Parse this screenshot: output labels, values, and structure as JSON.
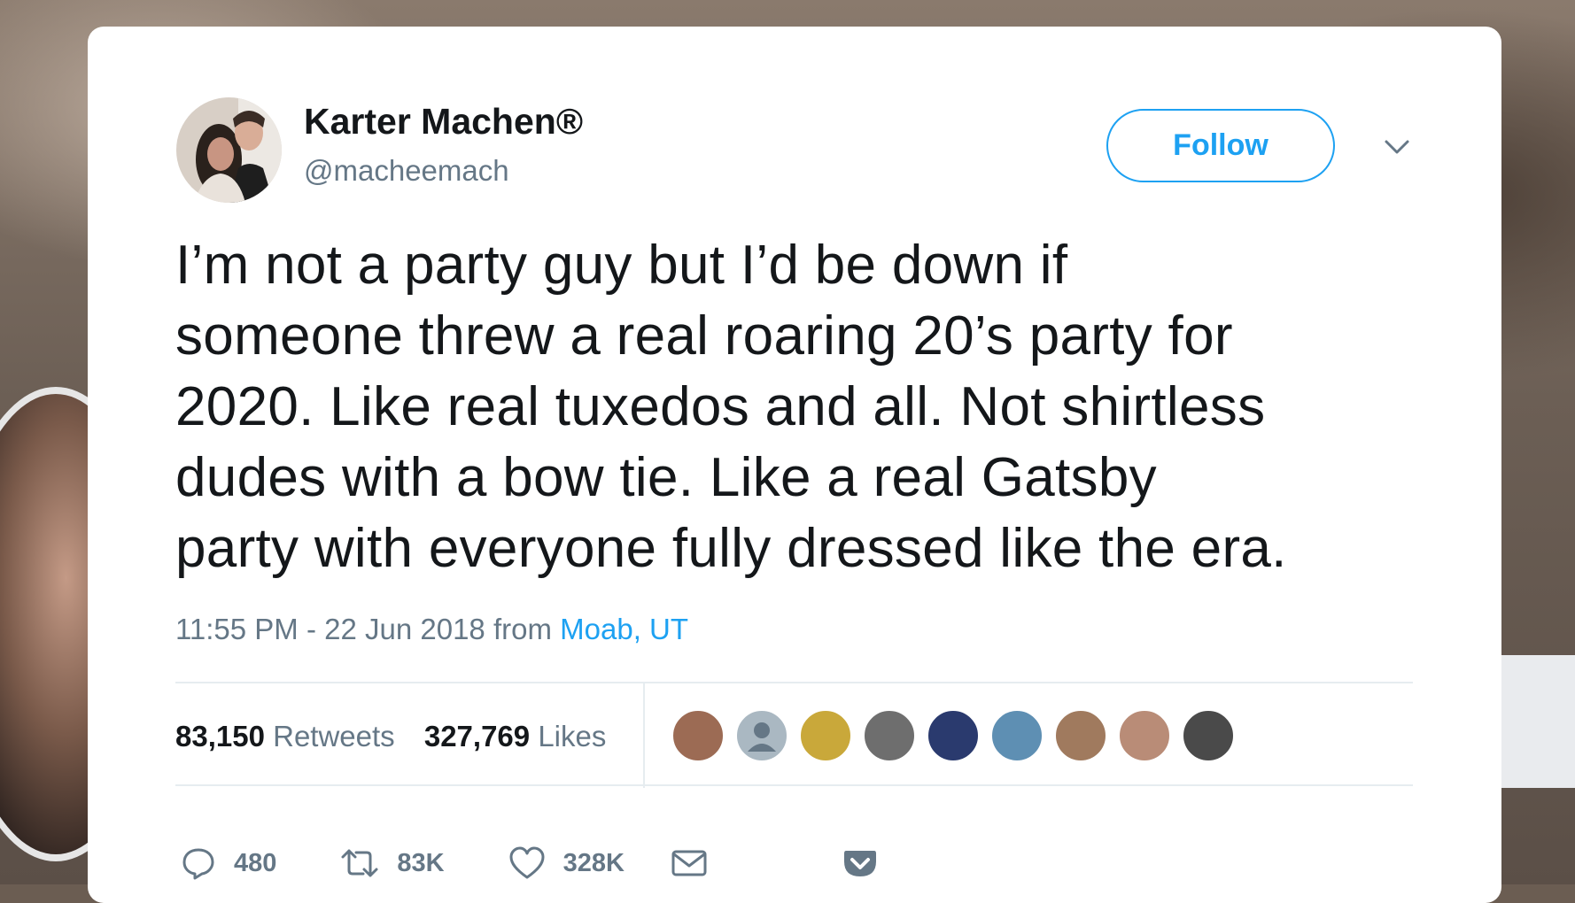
{
  "author": {
    "name": "Karter Machen®",
    "handle": "@macheemach"
  },
  "follow_button": {
    "label": "Follow"
  },
  "tweet": {
    "text_lines": [
      "I’m not a party guy but I’d be down if",
      "someone threw a real roaring 20’s party for",
      "2020. Like real tuxedos and all. Not shirtless",
      "dudes with a bow tie. Like a real Gatsby",
      "party with everyone fully dressed like the era."
    ],
    "time": "11:55 PM - 22 Jun 2018",
    "from_label": "from",
    "location": "Moab, UT"
  },
  "stats": {
    "retweets_count": "83,150",
    "retweets_label": "Retweets",
    "likes_count": "327,769",
    "likes_label": "Likes"
  },
  "likers": [
    {
      "color": "#9c6b54"
    },
    {
      "color": "#aab8c2"
    },
    {
      "color": "#c9a83a"
    },
    {
      "color": "#6e6e6e"
    },
    {
      "color": "#2a3a6e"
    },
    {
      "color": "#5e8fb3"
    },
    {
      "color": "#a07a5e"
    },
    {
      "color": "#b98c77"
    },
    {
      "color": "#4a4a4a"
    }
  ],
  "actions": {
    "reply_count": "480",
    "retweet_count": "83K",
    "like_count": "328K"
  },
  "icons": {
    "reply": "reply-icon",
    "retweet": "retweet-icon",
    "like": "heart-icon",
    "message": "envelope-icon",
    "pocket": "pocket-icon",
    "caret": "chevron-down-icon"
  },
  "colors": {
    "accent": "#1da1f2",
    "text": "#14171a",
    "secondary": "#657786"
  }
}
